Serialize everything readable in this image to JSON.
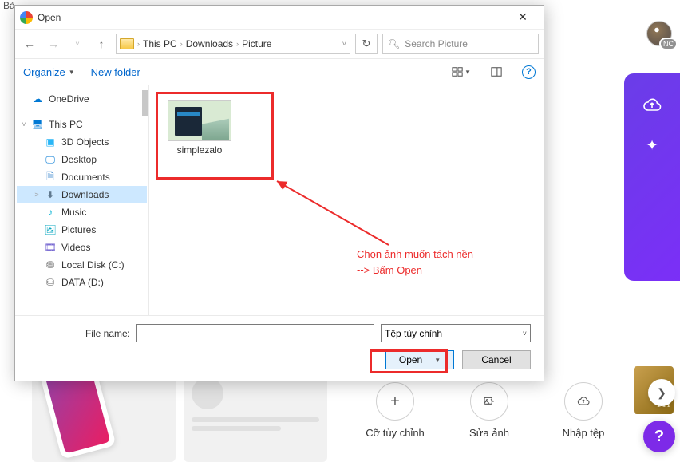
{
  "background": {
    "header_fragment": "Bả",
    "avatar_badge": "NC",
    "help": "?",
    "bottom_buttons": [
      {
        "glyph": "+",
        "label": "Cỡ tùy chỉnh"
      },
      {
        "glyph": "⤢",
        "label": "Sửa ảnh"
      },
      {
        "glyph": "☁",
        "label": "Nhập tệp"
      }
    ],
    "card_th": "TH"
  },
  "dialog": {
    "title": "Open",
    "breadcrumb": [
      "This PC",
      "Downloads",
      "Picture"
    ],
    "search_placeholder": "Search Picture",
    "toolbar": {
      "organize": "Organize",
      "new_folder": "New folder"
    },
    "tree": [
      {
        "label": "OneDrive",
        "icon": "onedrive",
        "level": 1
      },
      {
        "label": "This PC",
        "icon": "thispc",
        "level": 1,
        "expand": "˅"
      },
      {
        "label": "3D Objects",
        "icon": "3d",
        "level": 2
      },
      {
        "label": "Desktop",
        "icon": "desktop",
        "level": 2
      },
      {
        "label": "Documents",
        "icon": "docs",
        "level": 2
      },
      {
        "label": "Downloads",
        "icon": "downloads",
        "level": 2,
        "selected": true,
        "expand": "˃"
      },
      {
        "label": "Music",
        "icon": "music",
        "level": 2
      },
      {
        "label": "Pictures",
        "icon": "pictures",
        "level": 2
      },
      {
        "label": "Videos",
        "icon": "videos",
        "level": 2
      },
      {
        "label": "Local Disk (C:)",
        "icon": "disk",
        "level": 2
      },
      {
        "label": "DATA (D:)",
        "icon": "disk",
        "level": 2
      }
    ],
    "files": [
      {
        "name": "simplezalo"
      }
    ],
    "footer": {
      "filename_label": "File name:",
      "filename_value": "",
      "filter": "Tệp tùy chỉnh",
      "open": "Open",
      "cancel": "Cancel"
    }
  },
  "annotation": {
    "line1": "Chọn ảnh muốn tách nền",
    "line2": "--> Bấm Open"
  }
}
